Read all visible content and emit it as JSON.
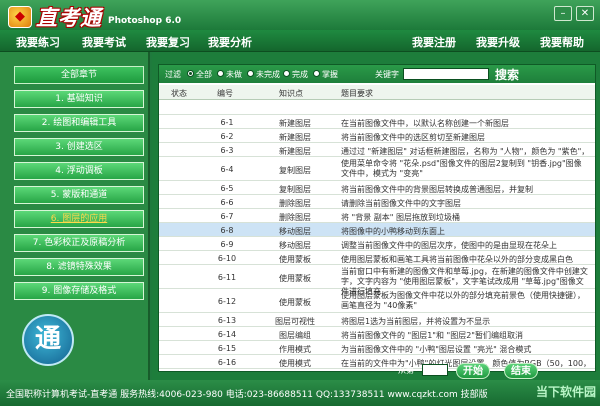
{
  "app": {
    "logo_text": "直考通",
    "logo_sub": "Photoshop 6.0",
    "win_min": "–",
    "win_close": "✕"
  },
  "menu": {
    "left": [
      "我要练习",
      "我要考试",
      "我要复习",
      "我要分析"
    ],
    "right": [
      "我要注册",
      "我要升级",
      "我要帮助"
    ]
  },
  "sidebar": {
    "heading": "全部章节",
    "items": [
      "1. 基础知识",
      "2. 绘图和编辑工具",
      "3. 创建选区",
      "4. 浮动调板",
      "5. 蒙版和通道",
      "6. 图层的应用",
      "7. 色彩校正及原稿分析",
      "8. 滤镜特殊效果",
      "9. 图像存储及格式"
    ],
    "active_index": 5,
    "seal_glyph": "通"
  },
  "filter": {
    "label": "过滤",
    "options": [
      "全部",
      "未做",
      "未完成",
      "完成",
      "掌握"
    ],
    "selected": "全部",
    "keyword_label": "关键字",
    "keyword_value": "",
    "search_label": "搜索"
  },
  "table": {
    "headers": [
      "状态",
      "编号",
      "知识点",
      "题目要求"
    ],
    "rows": [
      {
        "id": "",
        "kp": "",
        "q": ""
      },
      {
        "id": "6-1",
        "kp": "新建图层",
        "q": "在当前图像文件中，以默认名称创建一个新图层"
      },
      {
        "id": "6-2",
        "kp": "新建图层",
        "q": "将当前图像文件中的选区剪切至新建图层"
      },
      {
        "id": "6-3",
        "kp": "新建图层",
        "q": "通过过 \"新建图层\" 对话框新建图层，名称为 \"人物\"，颜色为 \"紫色\"，不透明度为 \"50%\""
      },
      {
        "id": "6-4",
        "kp": "复制图层",
        "q": "使用菜单命令将 \"花朵.psd\"图像文件的图层2复制到 \"钥香.jpg\"图像文件中，模式为 \"变亮\""
      },
      {
        "id": "6-5",
        "kp": "复制图层",
        "q": "将当前图像文件中的背景图层转换成普通图层，并复制"
      },
      {
        "id": "6-6",
        "kp": "删除图层",
        "q": "请删除当前图像文件中的文字图层"
      },
      {
        "id": "6-7",
        "kp": "删除图层",
        "q": "将 \"背景 副本\" 图层拖放到垃圾桶"
      },
      {
        "id": "6-8",
        "kp": "移动图层",
        "q": "将图像中的小鸭移动到东面上"
      },
      {
        "id": "6-9",
        "kp": "移动图层",
        "q": "调整当前图像文件中的图层次序，使图中的是由显现在花朵上"
      },
      {
        "id": "6-10",
        "kp": "使用蒙板",
        "q": "使用图层蒙板和画笔工具将当前图像中花朵以外的部分变成黑白色"
      },
      {
        "id": "6-11",
        "kp": "使用蒙板",
        "q": "当前窗口中有新建的图像文件和草莓.jpg，在新建的图像文件中创建文字，文字内容为 \"使用图层蒙板\"，文字笔试改成用 \"草莓.jpg\"图像文件进行填充"
      },
      {
        "id": "6-12",
        "kp": "使用蒙板",
        "q": "使用图层蒙板为图像文件中花以外的部分填充前景色（使用快捷键），画笔直径为 \"40像素\""
      },
      {
        "id": "6-13",
        "kp": "图层可视性",
        "q": "将图层1选为当前图层，并将设置为不显示"
      },
      {
        "id": "6-14",
        "kp": "图层编组",
        "q": "将当前图像文件的 \"图层1\"和 \"图层2\"暂们编组取消"
      },
      {
        "id": "6-15",
        "kp": "作用模式",
        "q": "为当前图像文件中的 \"小鸭\"图层设置 \"亮光\" 混合模式"
      },
      {
        "id": "6-16",
        "kp": "使用模式",
        "q": "在当前的文件中为\"小鸭\"的灯光图层设置，颜色值为RGB（50，100，250）"
      }
    ],
    "highlight_id": "6-8"
  },
  "nav": {
    "prefix": "从第",
    "start_label": "开始",
    "end_label": "结束"
  },
  "status": {
    "text": "全国职称计算机考试-直考通  服务热线:4006-023-980  电话:023-86688511  QQ:133738511  www.cqzkt.com  技部版",
    "watermark": "当下软件园"
  }
}
